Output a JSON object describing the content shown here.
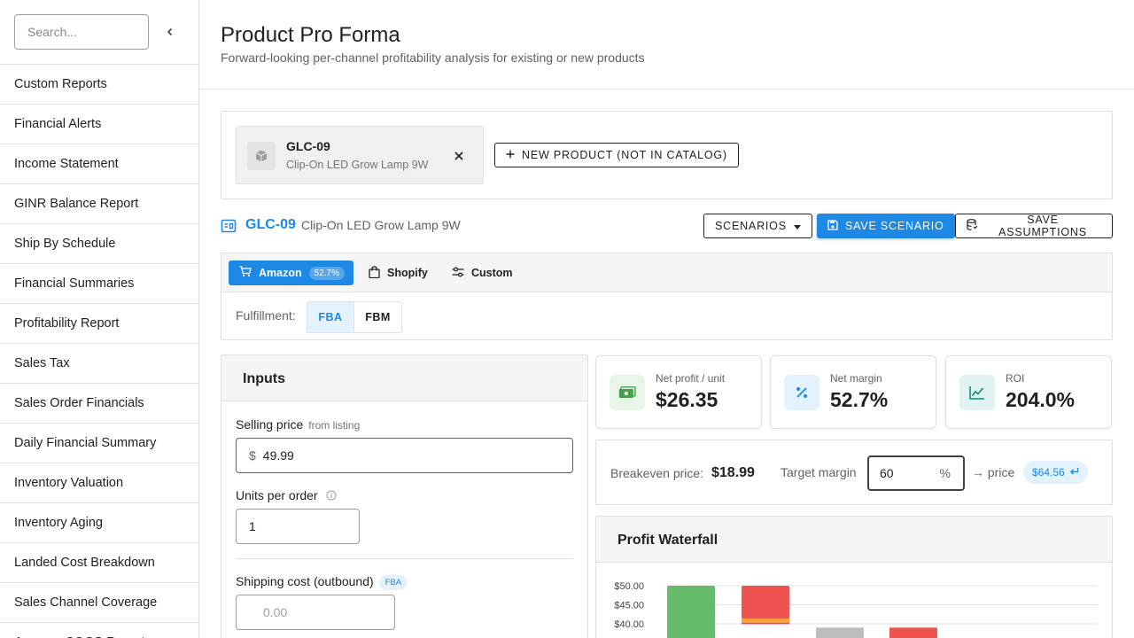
{
  "sidebar": {
    "search_placeholder": "Search...",
    "items": [
      "Custom Reports",
      "Financial Alerts",
      "Income Statement",
      "GINR Balance Report",
      "Ship By Schedule",
      "Financial Summaries",
      "Profitability Report",
      "Sales Tax",
      "Sales Order Financials",
      "Daily Financial Summary",
      "Inventory Valuation",
      "Inventory Aging",
      "Landed Cost Breakdown",
      "Sales Channel Coverage",
      "Amazon COGS Report"
    ]
  },
  "header": {
    "title": "Product Pro Forma",
    "subtitle": "Forward-looking per-channel profitability analysis for existing or new products"
  },
  "product_chip": {
    "sku": "GLC-09",
    "name": "Clip-On LED Grow Lamp 9W"
  },
  "buttons": {
    "new_product": "NEW PRODUCT (NOT IN CATALOG)",
    "scenarios": "SCENARIOS",
    "save_scenario": "SAVE SCENARIO",
    "save_assumptions": "SAVE ASSUMPTIONS"
  },
  "selected": {
    "sku": "GLC-09",
    "name": "Clip-On LED Grow Lamp 9W"
  },
  "channels": {
    "amazon": "Amazon",
    "amazon_badge": "52.7%",
    "shopify": "Shopify",
    "custom": "Custom"
  },
  "fulfillment": {
    "label": "Fulfillment:",
    "fba": "FBA",
    "fbm": "FBM"
  },
  "inputs": {
    "title": "Inputs",
    "selling_price_label": "Selling price",
    "selling_price_hint": "from listing",
    "currency": "$",
    "selling_price_value": "49.99",
    "units_label": "Units per order",
    "units_value": "1",
    "shipping_label": "Shipping cost (outbound)",
    "shipping_badge": "FBA",
    "shipping_placeholder": "0.00"
  },
  "kpis": {
    "net_profit_label": "Net profit / unit",
    "net_profit_value": "$26.35",
    "net_margin_label": "Net margin",
    "net_margin_value": "52.7%",
    "roi_label": "ROI",
    "roi_value": "204.0%"
  },
  "breakeven": {
    "label": "Breakeven price:",
    "value": "$18.99",
    "target_label": "Target margin",
    "target_value": "60",
    "pct": "%",
    "arrow_price": "→ price",
    "price_chip": "$64.56"
  },
  "colors": {
    "primary": "#1e88e5",
    "profit_green": "#66bb6a",
    "cost_red": "#ef5350",
    "fee_orange": "#ffa726",
    "fee_pink": "#ec407a",
    "neutral_gray": "#bdbdbd"
  },
  "chart_data": {
    "type": "bar",
    "title": "Profit Waterfall",
    "y_tick_labels": [
      "$50.00",
      "$45.00",
      "$40.00"
    ],
    "ylim": [
      35,
      50
    ],
    "grid": true,
    "bars": [
      {
        "color": "#66bb6a",
        "start": 0,
        "end": 49.99
      },
      {
        "color": "#ef5350",
        "start": 41.3,
        "end": 49.99
      },
      {
        "color": "#ffa726",
        "start": 40.3,
        "end": 41.3
      },
      {
        "color": "#ec407a",
        "start": 39.9,
        "end": 40.3
      },
      {
        "color": "#bdbdbd",
        "start": 0,
        "end": 39.0
      },
      {
        "color": "#ef5350",
        "start": 0,
        "end": 39.0
      }
    ]
  }
}
